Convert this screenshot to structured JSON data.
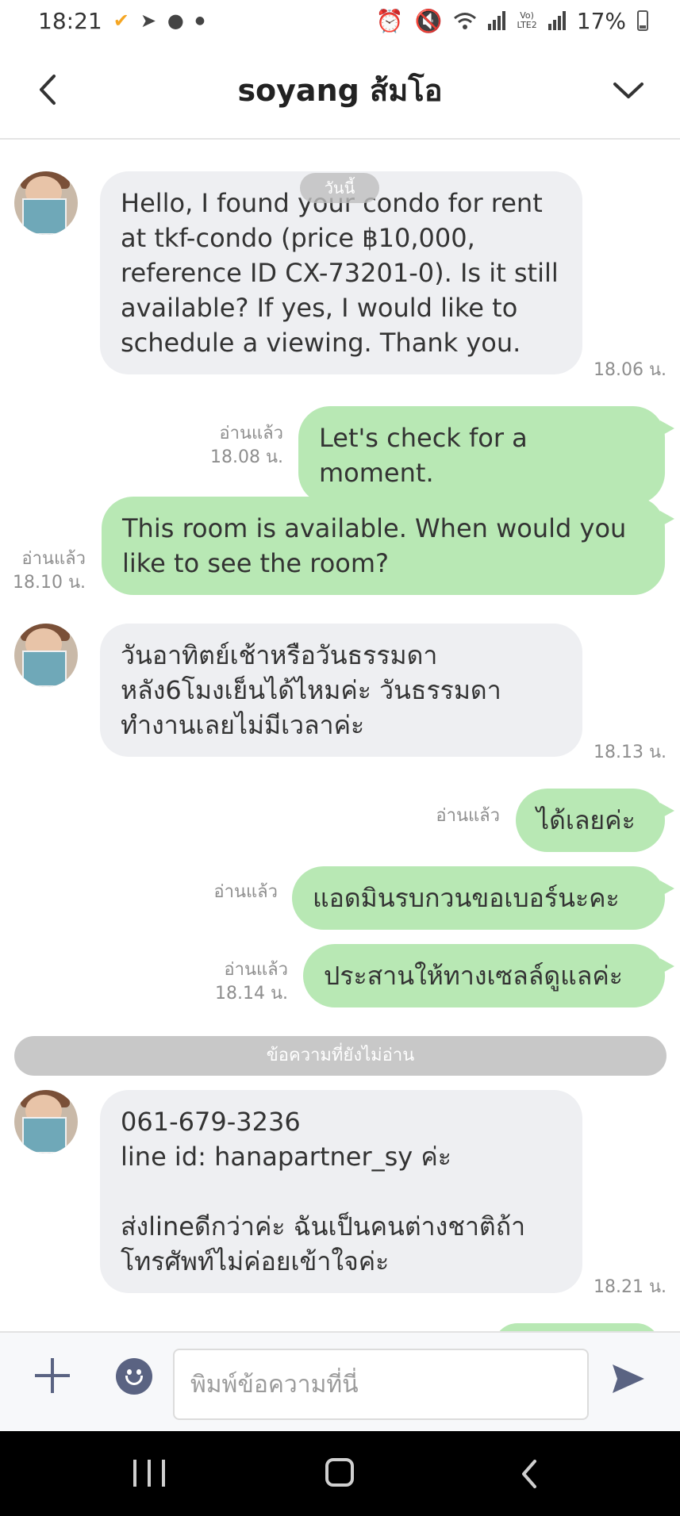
{
  "status_bar": {
    "time": "18:21",
    "battery": "17%",
    "icons": [
      "app-notification-icon",
      "send-icon",
      "chat-bubble-icon",
      "dot-icon",
      "alarm-icon",
      "mute-icon",
      "wifi-icon",
      "signal-icon",
      "volte-icon",
      "signal-icon",
      "battery-icon"
    ],
    "volte_label": "Vo)\nLTE2"
  },
  "header": {
    "title": "soyang ส้มโอ"
  },
  "chat": {
    "date_label": "วันนี้",
    "messages": [
      {
        "from": "in",
        "text": "Hello, I found your condo for rent\nat tkf-condo (price ฿10,000,\nreference ID CX-73201-0). Is it still\navailable? If yes, I would like to\nschedule a viewing. Thank you.",
        "time": "18.06 น."
      },
      {
        "from": "out",
        "text": "Let's check for a moment.",
        "read": "อ่านแล้ว",
        "time": "18.08 น."
      },
      {
        "from": "out",
        "text": "This room is available. When would you\nlike to see the room?",
        "read": "อ่านแล้ว",
        "time": "18.10 น."
      },
      {
        "from": "in",
        "text": "วันอาทิตย์เช้าหรือวันธรรมดา\nหลัง6โมงเย็นได้ไหมค่ะ วันธรรมดา\nทำงานเลยไม่มีเวลาค่ะ",
        "time": "18.13 น."
      },
      {
        "from": "out",
        "text": "ได้เลยค่ะ",
        "read": "อ่านแล้ว",
        "time": ""
      },
      {
        "from": "out",
        "text": "แอดมินรบกวนขอเบอร์นะคะ",
        "read": "อ่านแล้ว",
        "time": ""
      },
      {
        "from": "out",
        "text": "ประสานให้ทางเซลล์ดูแลค่ะ",
        "read": "อ่านแล้ว",
        "time": "18.14 น."
      },
      {
        "from": "in",
        "text": "061-679-3236\nline id: hanapartner_sy ค่ะ\n\nส่งlineดีกว่าค่ะ ฉันเป็นคนต่างชาติถ้า\nโทรศัพท์ไม่ค่อยเข้าใจค่ะ",
        "time": "18.21 น."
      }
    ],
    "unread_divider": "ข้อความที่ยังไม่อ่าน"
  },
  "input": {
    "placeholder": "พิมพ์ข้อความที่นี่",
    "value": ""
  },
  "colors": {
    "outgoing_bubble": "#b8e8b4",
    "incoming_bubble": "#eeeff2",
    "icon": "#5a6382"
  }
}
